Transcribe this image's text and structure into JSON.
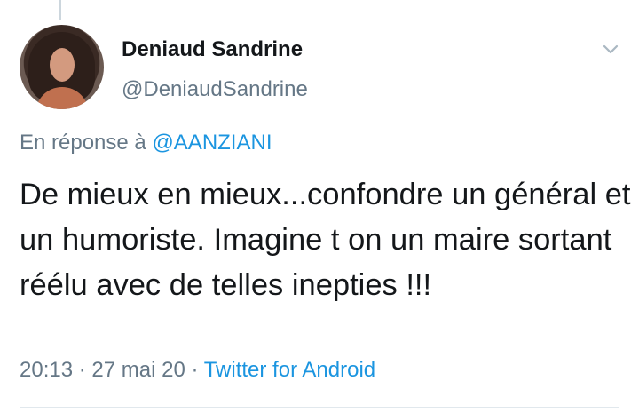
{
  "tweet": {
    "display_name": "Deniaud Sandrine",
    "handle": "@DeniaudSandrine",
    "reply_prefix": "En réponse à ",
    "reply_mention": "@AANZIANI",
    "text": "De mieux en mieux...confondre un général et un humoriste. Imagine t on un maire sortant réélu avec de telles inepties !!!",
    "time": "20:13",
    "separator": " · ",
    "date": "27 mai 20",
    "source": "Twitter for Android"
  },
  "colors": {
    "text": "#14171a",
    "secondary": "#657786",
    "link": "#1b95e0",
    "divider": "#e1e8ed"
  },
  "icons": {
    "menu": "chevron-down-icon",
    "avatar": "profile-photo"
  }
}
